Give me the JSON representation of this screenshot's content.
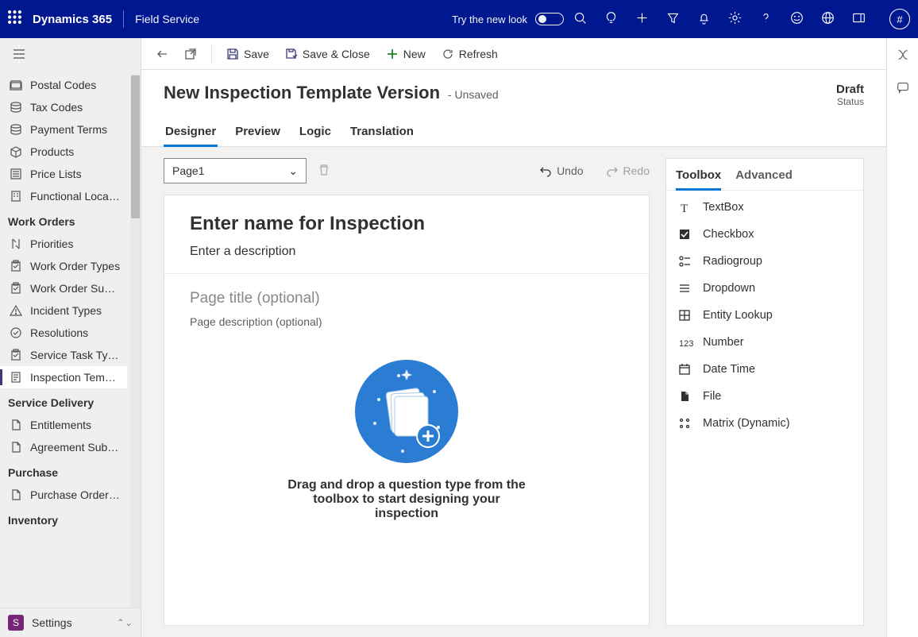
{
  "topbar": {
    "brand": "Dynamics 365",
    "app": "Field Service",
    "try_new_look": "Try the new look",
    "avatar": "#"
  },
  "sidenav": {
    "groups": [
      {
        "title": null,
        "items": [
          {
            "label": "Postal Codes",
            "icon": "tag"
          },
          {
            "label": "Tax Codes",
            "icon": "stack"
          },
          {
            "label": "Payment Terms",
            "icon": "stack"
          },
          {
            "label": "Products",
            "icon": "box"
          },
          {
            "label": "Price Lists",
            "icon": "list"
          },
          {
            "label": "Functional Locatio...",
            "icon": "building"
          }
        ]
      },
      {
        "title": "Work Orders",
        "items": [
          {
            "label": "Priorities",
            "icon": "priorities"
          },
          {
            "label": "Work Order Types",
            "icon": "clipboard"
          },
          {
            "label": "Work Order Subst...",
            "icon": "clipboard"
          },
          {
            "label": "Incident Types",
            "icon": "warning"
          },
          {
            "label": "Resolutions",
            "icon": "check"
          },
          {
            "label": "Service Task Types",
            "icon": "clipboard"
          },
          {
            "label": "Inspection Templa...",
            "icon": "inspection",
            "selected": true
          }
        ]
      },
      {
        "title": "Service Delivery",
        "items": [
          {
            "label": "Entitlements",
            "icon": "doc"
          },
          {
            "label": "Agreement Substa...",
            "icon": "doc"
          }
        ]
      },
      {
        "title": "Purchase",
        "items": [
          {
            "label": "Purchase Order S...",
            "icon": "doc"
          }
        ]
      },
      {
        "title": "Inventory",
        "items": []
      }
    ],
    "footer": {
      "badge": "S",
      "label": "Settings"
    }
  },
  "cmdbar": {
    "save": "Save",
    "save_close": "Save & Close",
    "new": "New",
    "refresh": "Refresh"
  },
  "record": {
    "title": "New Inspection Template Version",
    "unsaved": "- Unsaved",
    "status_value": "Draft",
    "status_label": "Status",
    "tabs": [
      "Designer",
      "Preview",
      "Logic",
      "Translation"
    ],
    "active_tab": 0
  },
  "designer": {
    "page_selector": "Page1",
    "undo": "Undo",
    "redo": "Redo",
    "name_placeholder": "Enter name for Inspection",
    "desc_placeholder": "Enter a description",
    "page_title_placeholder": "Page title (optional)",
    "page_desc_placeholder": "Page description (optional)",
    "empty_message": "Drag and drop a question type from the toolbox to start designing your inspection"
  },
  "sidepanel": {
    "tabs": [
      "Toolbox",
      "Advanced"
    ],
    "active_tab": 0,
    "tools": [
      {
        "label": "TextBox",
        "icon": "T"
      },
      {
        "label": "Checkbox",
        "icon": "checkbox"
      },
      {
        "label": "Radiogroup",
        "icon": "radio"
      },
      {
        "label": "Dropdown",
        "icon": "dropdown"
      },
      {
        "label": "Entity Lookup",
        "icon": "grid"
      },
      {
        "label": "Number",
        "icon": "number"
      },
      {
        "label": "Date Time",
        "icon": "calendar"
      },
      {
        "label": "File",
        "icon": "file"
      },
      {
        "label": "Matrix (Dynamic)",
        "icon": "matrix"
      }
    ]
  }
}
